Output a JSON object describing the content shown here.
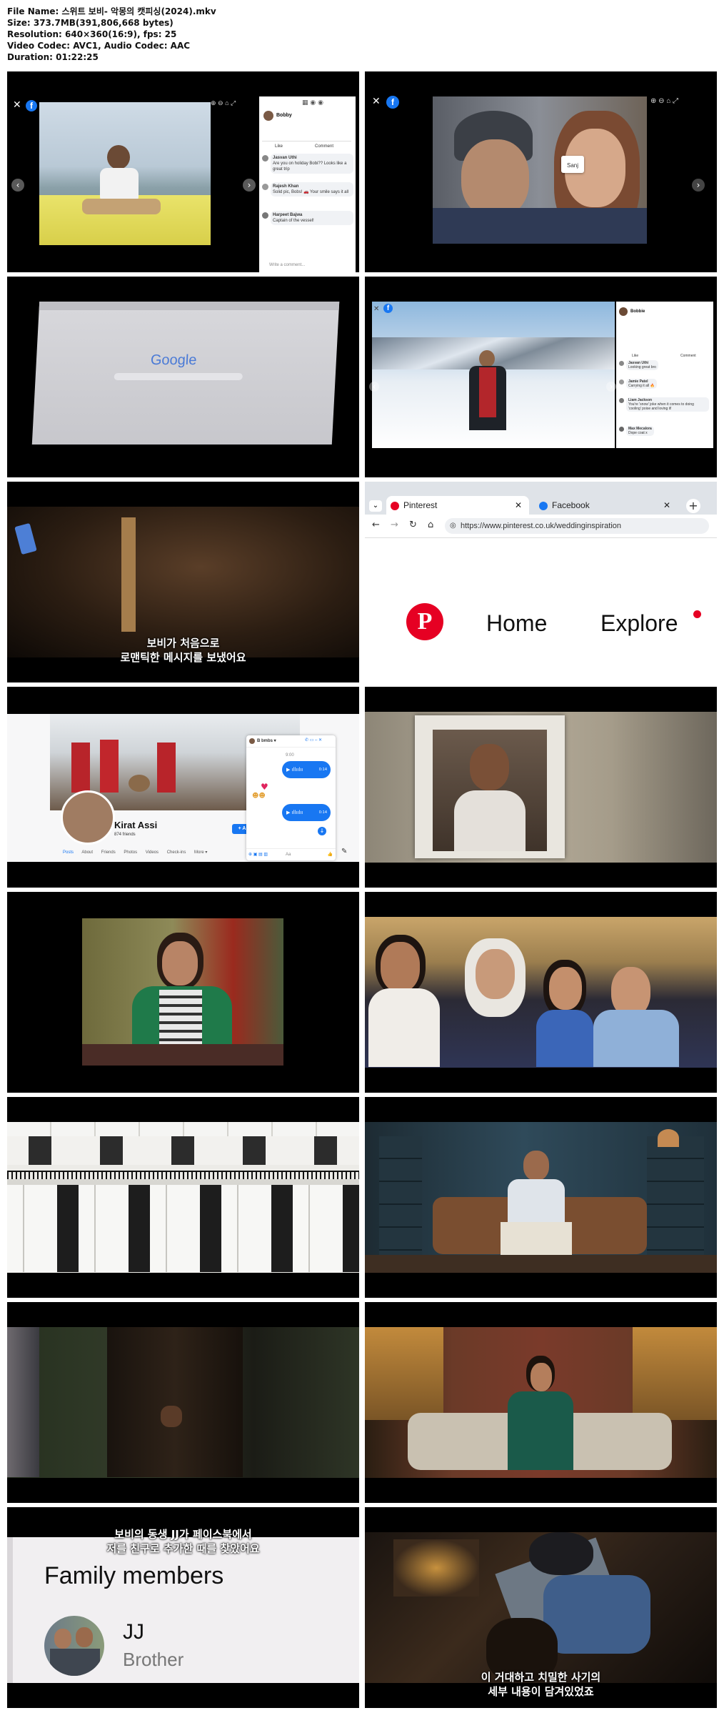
{
  "header": {
    "file_name": "File Name: 스위트 보비- 악몽의 캣피싱(2024).mkv",
    "size": "Size: 373.7MB(391,806,668 bytes)",
    "resolution": "Resolution: 640×360(16:9), fps: 25",
    "codec": "Video Codec: AVC1, Audio Codec: AAC",
    "duration": "Duration: 01:22:25"
  },
  "thumb1": {
    "profile_name": "Bobby",
    "like_label": "Like",
    "comment_label": "Comment",
    "comments": [
      {
        "name": "Jasvan Uthi",
        "text": "Are you on holiday Bobi?? Looks like a great trip"
      },
      {
        "name": "Rajesh Khan",
        "text": "Solid pic, Bobs! 🚗 Your smile says it all"
      },
      {
        "name": "Harpeet Bajwa",
        "text": "Captain of the vessel!"
      }
    ],
    "comment_actions": "Like   Reply",
    "write_comment": "Write a comment..."
  },
  "thumb2": {
    "tag_label": "Sanj"
  },
  "thumb3": {
    "logo": "Google"
  },
  "thumb4": {
    "profile_name": "Bobbie",
    "like_label": "Like",
    "comment_label": "Comment",
    "comments": [
      {
        "name": "Jasvan Uthi",
        "text": "Looking great bro"
      },
      {
        "name": "Jamie Patel",
        "text": "Carrying it all 🔥"
      },
      {
        "name": "Liam Jackson",
        "text": "You're 'snow' joke when it comes to doing 'cooling' poise and loving it!"
      },
      {
        "name": "Max Mecalora",
        "text": "Dope coat x"
      }
    ]
  },
  "thumb5": {
    "subtitle_line1": "보비가 처음으로",
    "subtitle_line2": "로맨틱한 메시지를 보냈어요"
  },
  "thumb6": {
    "tab1": "Pinterest",
    "tab2": "Facebook",
    "url": "https://www.pinterest.co.uk/weddinginspiration",
    "nav_home": "Home",
    "nav_explore": "Explore",
    "brand_color": "#e60023"
  },
  "thumb7": {
    "name": "Kirat Assi",
    "friends": "874 friends",
    "tabs": [
      "Posts",
      "About",
      "Friends",
      "Photos",
      "Videos",
      "Check-ins",
      "More ▾"
    ],
    "chat_name": "B bmbs ▾",
    "chat_time": "9:00",
    "voice_duration_1": "0:14",
    "voice_duration_2": "0:14",
    "chat_input": "Aa",
    "add_button": "+ A"
  },
  "thumb17": {
    "subtitle_line1": "보비의 동생 JJ가 페이스북에서",
    "subtitle_line2": "저를 친구로 추가한 때를 찾았어요",
    "heading": "Family members",
    "member_name": "JJ",
    "member_relation": "Brother"
  },
  "thumb18": {
    "subtitle_line1": "이 거대하고 치밀한 사기의",
    "subtitle_line2": "세부 내용이 담겨있었죠"
  }
}
